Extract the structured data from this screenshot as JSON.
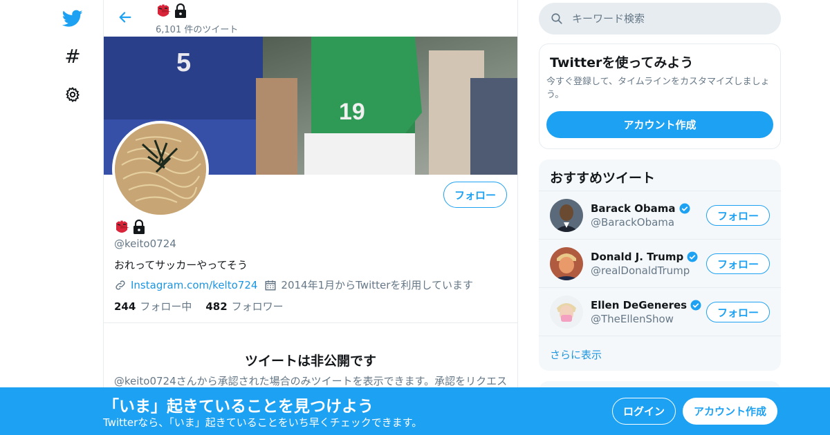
{
  "nav": {
    "icons": [
      "twitter-logo-icon",
      "hashtag-icon",
      "gear-icon"
    ],
    "hash_glyph": "#"
  },
  "header": {
    "tweet_count": "6,101 件のツイート"
  },
  "profile": {
    "handle": "@keito0724",
    "bio": "おれってサッカーやってそう",
    "link": "Instagram.com/kelto724",
    "joined": "2014年1月からTwitterを利用しています",
    "following_count": "244",
    "following_label": "フォロー中",
    "followers_count": "482",
    "followers_label": "フォロワー",
    "follow_button": "フォロー"
  },
  "private": {
    "title": "ツイートは非公開です",
    "text": "@keito0724さんから承認された場合のみツイートを表示できます。承認をリクエス"
  },
  "search": {
    "placeholder": "キーワード検索"
  },
  "signup_card": {
    "title": "Twitterを使ってみよう",
    "description": "今すぐ登録して、タイムラインをカスタマイズしましょう。",
    "button": "アカウント作成"
  },
  "recommendations": {
    "title": "おすすめツイート",
    "items": [
      {
        "name": "Barack Obama",
        "handle": "@BarackObama",
        "follow": "フォロー"
      },
      {
        "name": "Donald J. Trump",
        "handle": "@realDonaldTrump",
        "follow": "フォロー"
      },
      {
        "name": "Ellen DeGeneres",
        "handle": "@TheEllenShow",
        "follow": "フォロー"
      }
    ],
    "show_more": "さらに表示"
  },
  "bottom_bar": {
    "title": "「いま」起きていることを見つけよう",
    "subtitle": "Twitterなら、「いま」起きていることをいち早くチェックできます。",
    "login": "ログイン",
    "signup": "アカウント作成"
  },
  "colors": {
    "accent": "#1da1f2",
    "text": "#14171a",
    "muted": "#657786",
    "border": "#e6ecf0"
  }
}
